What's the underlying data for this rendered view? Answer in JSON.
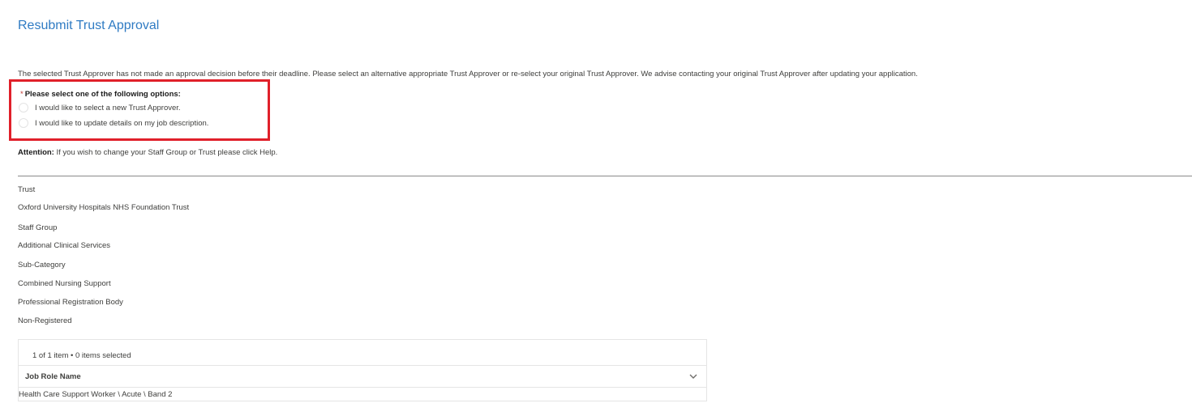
{
  "page": {
    "title": "Resubmit Trust Approval",
    "intro": "The selected Trust Approver has not made an approval decision before their deadline. Please select an alternative appropriate Trust Approver or re-select your original Trust Approver. We advise contacting your original Trust Approver after updating your application."
  },
  "options": {
    "required_marker": "*",
    "label": "Please select one of the following options:",
    "items": [
      {
        "label": "I would like to select a new Trust Approver."
      },
      {
        "label": "I would like to update details on my job description."
      }
    ]
  },
  "attention": {
    "label": "Attention:",
    "text": "If you wish to change your Staff Group or Trust please click Help."
  },
  "details": {
    "trust_label": "Trust",
    "trust_value": "Oxford University Hospitals NHS Foundation Trust",
    "staff_group_label": "Staff Group",
    "staff_group_value": "Additional Clinical Services",
    "sub_category_label": "Sub-Category",
    "sub_category_value": "Combined Nursing Support",
    "registration_label": "Professional Registration Body",
    "registration_value": "Non-Registered"
  },
  "table": {
    "meta": "1 of 1 item • 0 items selected",
    "column_header": "Job Role Name",
    "rows": [
      {
        "job_role": "Health Care Support Worker \\ Acute \\ Band 2"
      }
    ]
  },
  "colors": {
    "title": "#2f7bc3",
    "highlight_box": "#e0202a",
    "required": "#c23934"
  }
}
